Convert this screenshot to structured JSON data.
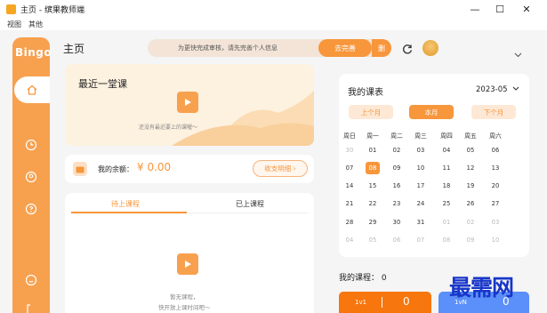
{
  "window": {
    "title": "主页 - 缤果教师端",
    "min": "—",
    "max": "☐",
    "close": "✕"
  },
  "menu": [
    "视图",
    "其他"
  ],
  "sidebar": {
    "logo": "Bingo"
  },
  "header": {
    "title": "主页",
    "notice": "为更快完成审核，请先完善个人信息",
    "notice_btn": "去完善",
    "notice_btn2": "删"
  },
  "recent": {
    "title": "最近一堂课",
    "empty": "还没有最近要上的课喔～"
  },
  "balance": {
    "label": "我的余额：",
    "value": "¥ 0.00",
    "button": "收支明细 ›"
  },
  "courses": {
    "tab_pending": "待上课程",
    "tab_done": "已上课程",
    "empty_line1": "暂无课程，",
    "empty_line2": "快开放上课时间吧～"
  },
  "schedule": {
    "title": "我的课表",
    "month": "2023-05",
    "prev": "上个月",
    "current": "本月",
    "next": "下个月",
    "weekdays": [
      "周日",
      "周一",
      "周二",
      "周三",
      "周四",
      "周五",
      "周六"
    ],
    "rows": [
      [
        "30",
        "01",
        "02",
        "03",
        "04",
        "05",
        "06"
      ],
      [
        "07",
        "08",
        "09",
        "10",
        "11",
        "12",
        "13"
      ],
      [
        "14",
        "15",
        "16",
        "17",
        "18",
        "19",
        "20"
      ],
      [
        "21",
        "22",
        "23",
        "24",
        "25",
        "26",
        "27"
      ],
      [
        "28",
        "29",
        "30",
        "31",
        "01",
        "02",
        "03"
      ],
      [
        "04",
        "05",
        "06",
        "07",
        "08",
        "09",
        "10"
      ]
    ]
  },
  "my_course": {
    "label": "我的课程：",
    "count": "0",
    "btn_1v1": "1v1",
    "btn_1v1_count": "0",
    "btn_1vn": "1vN",
    "btn_1vn_count": "0"
  },
  "watermark": "最需网",
  "colors": {
    "accent": "#f7963b",
    "sidebar": "#f7a14f",
    "blue": "#5b8ff9"
  }
}
